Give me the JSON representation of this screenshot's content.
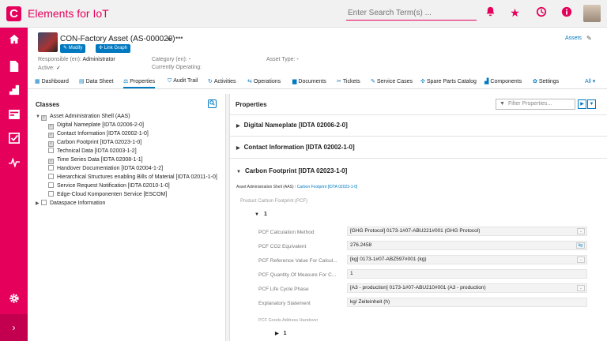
{
  "app": {
    "title": "Elements for IoT",
    "logo_letter": "C"
  },
  "search": {
    "placeholder": "Enter Search Term(s) ..."
  },
  "topbar_icons": [
    "bell-icon",
    "star-icon",
    "history-icon",
    "info-icon",
    "user-avatar"
  ],
  "sidebar": {
    "items": [
      "home-icon",
      "document-icon",
      "stairs-icon",
      "inbox-icon",
      "checklist-icon",
      "pulse-icon"
    ],
    "bottom": [
      "settings-icon",
      "expand-icon"
    ]
  },
  "asset": {
    "title": "CON-Factory Asset (AS-000020)",
    "buttons": {
      "modify": "Modify",
      "link_graph": "Link Graph"
    },
    "responsible_label": "Responsible (en):",
    "responsible_value": "Administrator",
    "active_label": "Active:",
    "active_value": "✓",
    "category_label": "Category (en):",
    "category_value": "-",
    "currently_operating_label": "Currently Operating:",
    "asset_type_label": "Asset Type:",
    "asset_type_value": "-",
    "assets_link": "Assets"
  },
  "tabs": [
    {
      "label": "Dashboard",
      "icon": "▦"
    },
    {
      "label": "Data Sheet",
      "icon": "▤"
    },
    {
      "label": "Properties",
      "icon": "⚖"
    },
    {
      "label": "Audit Trail",
      "icon": "⛉"
    },
    {
      "label": "Activities",
      "icon": "↻"
    },
    {
      "label": "Operations",
      "icon": "⇆"
    },
    {
      "label": "Documents",
      "icon": "▆"
    },
    {
      "label": "Tickets",
      "icon": "✂"
    },
    {
      "label": "Service Cases",
      "icon": "✎"
    },
    {
      "label": "Spare Parts Catalog",
      "icon": "✣"
    },
    {
      "label": "Components",
      "icon": "▟"
    },
    {
      "label": "Settings",
      "icon": "✿"
    }
  ],
  "tabs_all": "All ▾",
  "classes": {
    "title": "Classes",
    "tree": [
      {
        "label": "Asset Administration Shell (AAS)",
        "checked": true
      },
      {
        "label": "Digital Nameplate [IDTA 02006-2-0]",
        "checked": true
      },
      {
        "label": "Contact Information [IDTA 02002-1-0]",
        "checked": true
      },
      {
        "label": "Carbon Footprint [IDTA 02023-1-0]",
        "checked": true
      },
      {
        "label": "Technical Data [IDTA 02003-1-2]",
        "checked": false
      },
      {
        "label": "Time Series Data [IDTA 02008-1-1]",
        "checked": true
      },
      {
        "label": "Handover Documentation [IDTA 02004-1-2]",
        "checked": false
      },
      {
        "label": "Hierarchical Structures enabling Bills of Material [IDTA 02011-1-0]",
        "checked": false
      },
      {
        "label": "Service Request Notification [IDTA 02010-1-0]",
        "checked": false
      },
      {
        "label": "Edge-Cloud Komponenten Service [ESCOM]",
        "checked": false
      },
      {
        "label": "Dataspace Information",
        "checked": false
      }
    ]
  },
  "properties": {
    "title": "Properties",
    "filter_placeholder": "Filter Properties...",
    "sections": [
      "Digital Nameplate [IDTA 02006-2-0]",
      "Contact Information [IDTA 02002-1-0]",
      "Carbon Footprint [IDTA 02023-1-0]"
    ],
    "breadcrumb_root": "Asset Administration Shell (AAS)",
    "breadcrumb_sep": "/",
    "breadcrumb_current": "Carbon Footprint [IDTA 02023-1-0]",
    "pcf_group": "Product Carbon Footprint (PCF)",
    "item_index": "1",
    "rows": [
      {
        "label": "PCF Calculation Method",
        "value": "[GHG Protocol] 0173-1#07-ABU221#001 (GHG Protocol)",
        "control": "dropdown"
      },
      {
        "label": "PCF CO2 Equivalent",
        "value": "276.2458",
        "control": "unit",
        "unit": "kg"
      },
      {
        "label": "PCF Reference Value For Calcul...",
        "value": "[kg] 0173-1#07-ABZ597#001 (kg)",
        "control": "dropdown"
      },
      {
        "label": "PCF Quantity Of Measure For C...",
        "value": "1",
        "control": "none"
      },
      {
        "label": "PCF Life Cycle Phase",
        "value": "[A3 - production] 0173-1#07-ABU210#001 (A3 - production)",
        "control": "dropdown"
      },
      {
        "label": "Explanatory Statement",
        "value": "kg/ Zeiteinheit (h)",
        "control": "none"
      }
    ],
    "goods_address": "PCF Goods Address Handover",
    "sub_index": "1"
  }
}
